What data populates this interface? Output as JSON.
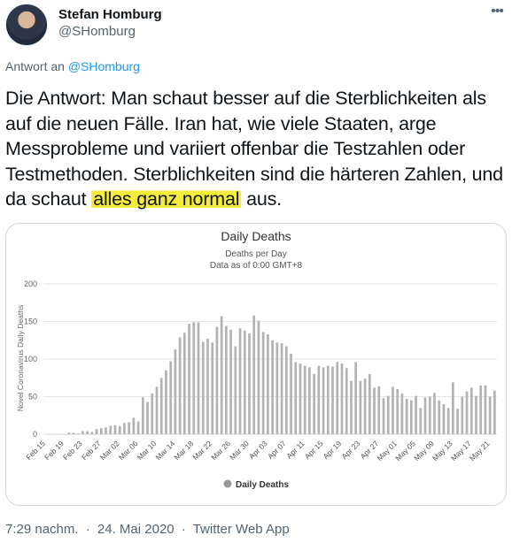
{
  "user": {
    "name": "Stefan Homburg",
    "handle": "@SHomburg"
  },
  "reply": {
    "prefix": "Antwort an",
    "to": "@SHomburg"
  },
  "tweet": {
    "text_before": "Die Antwort: Man schaut besser auf die Sterblichkeiten als auf die neuen Fälle. Iran hat, wie viele Staaten, arge Messprobleme und variiert offenbar die Testzahlen oder Testmethoden. Sterblichkeiten sind die härteren Zahlen, und da schaut ",
    "highlight": "alles ganz normal",
    "text_after": " aus.",
    "highlight_color": "#f6ec3b"
  },
  "footer": {
    "time": "7:29 nachm.",
    "sep1": "·",
    "date": "24. Mai 2020",
    "sep2": "·",
    "source": "Twitter Web App"
  },
  "icons": {
    "more": "more-horizontal-icon",
    "avatar": "avatar-photo"
  },
  "chart_data": {
    "type": "bar",
    "title": "Daily Deaths",
    "subtitle_line1": "Deaths per Day",
    "subtitle_line2": "Data as of 0:00 GMT+8",
    "ylabel": "Novel Coronavirus Daily Deaths",
    "ylim": [
      0,
      200
    ],
    "yticks": [
      0,
      50,
      100,
      150,
      200
    ],
    "grid": true,
    "legend": "bottom",
    "bar_color": "#b3b3b3",
    "x_tick_labels": [
      "Feb 15",
      "Feb 19",
      "Feb 23",
      "Feb 27",
      "Mar 02",
      "Mar 06",
      "Mar 10",
      "Mar 14",
      "Mar 18",
      "Mar 22",
      "Mar 26",
      "Mar 30",
      "Apr 03",
      "Apr 07",
      "Apr 11",
      "Apr 15",
      "Apr 19",
      "Apr 23",
      "Apr 27",
      "May 01",
      "May 05",
      "May 09",
      "May 13",
      "May 17",
      "May 21"
    ],
    "series": [
      {
        "name": "Daily Deaths",
        "values": [
          0,
          0,
          0,
          0,
          0,
          2,
          2,
          1,
          4,
          4,
          3,
          7,
          8,
          9,
          11,
          12,
          11,
          15,
          16,
          22,
          17,
          49,
          43,
          54,
          63,
          75,
          85,
          97,
          113,
          129,
          135,
          147,
          149,
          149,
          123,
          127,
          122,
          143,
          157,
          144,
          139,
          117,
          141,
          138,
          134,
          158,
          151,
          136,
          133,
          125,
          122,
          121,
          117,
          107,
          96,
          94,
          91,
          89,
          80,
          91,
          89,
          91,
          90,
          96,
          94,
          88,
          71,
          96,
          71,
          74,
          80,
          62,
          64,
          48,
          51,
          63,
          60,
          54,
          47,
          45,
          51,
          35,
          49,
          50,
          55,
          45,
          40,
          35,
          69,
          34,
          50,
          57,
          62,
          51,
          65,
          65,
          50,
          58
        ]
      }
    ]
  }
}
